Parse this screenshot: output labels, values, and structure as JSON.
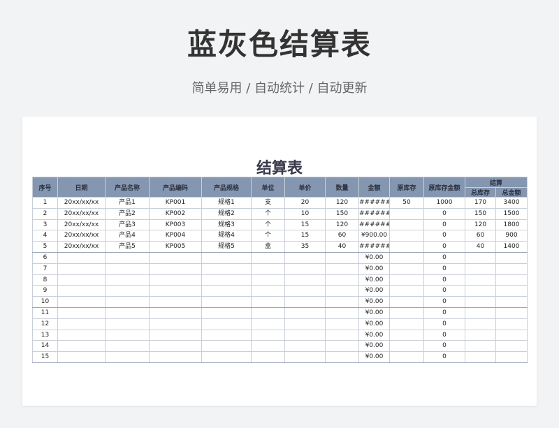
{
  "hero": {
    "title": "蓝灰色结算表",
    "subtitle": "简单易用 / 自动统计 / 自动更新"
  },
  "sheet": {
    "title": "结算表",
    "headers": [
      "序号",
      "日期",
      "产品名称",
      "产品编码",
      "产品规格",
      "单位",
      "单价",
      "数量",
      "金额",
      "原库存",
      "原库存金额"
    ],
    "group_header": "结算",
    "sub_headers": [
      "总库存",
      "总金额"
    ],
    "rows": [
      [
        "1",
        "20xx/xx/xx",
        "产品1",
        "KP001",
        "规格1",
        "支",
        "20",
        "120",
        "#######",
        "50",
        "1000",
        "170",
        "3400"
      ],
      [
        "2",
        "20xx/xx/xx",
        "产品2",
        "KP002",
        "规格2",
        "个",
        "10",
        "150",
        "#######",
        "",
        "0",
        "150",
        "1500"
      ],
      [
        "3",
        "20xx/xx/xx",
        "产品3",
        "KP003",
        "规格3",
        "个",
        "15",
        "120",
        "#######",
        "",
        "0",
        "120",
        "1800"
      ],
      [
        "4",
        "20xx/xx/xx",
        "产品4",
        "KP004",
        "规格4",
        "个",
        "15",
        "60",
        "¥900.00",
        "",
        "0",
        "60",
        "900"
      ],
      [
        "5",
        "20xx/xx/xx",
        "产品5",
        "KP005",
        "规格5",
        "盒",
        "35",
        "40",
        "#######",
        "",
        "0",
        "40",
        "1400"
      ],
      [
        "6",
        "",
        "",
        "",
        "",
        "",
        "",
        "",
        "¥0.00",
        "",
        "0",
        "",
        ""
      ],
      [
        "7",
        "",
        "",
        "",
        "",
        "",
        "",
        "",
        "¥0.00",
        "",
        "0",
        "",
        ""
      ],
      [
        "8",
        "",
        "",
        "",
        "",
        "",
        "",
        "",
        "¥0.00",
        "",
        "0",
        "",
        ""
      ],
      [
        "9",
        "",
        "",
        "",
        "",
        "",
        "",
        "",
        "¥0.00",
        "",
        "0",
        "",
        ""
      ],
      [
        "10",
        "",
        "",
        "",
        "",
        "",
        "",
        "",
        "¥0.00",
        "",
        "0",
        "",
        ""
      ],
      [
        "11",
        "",
        "",
        "",
        "",
        "",
        "",
        "",
        "¥0.00",
        "",
        "0",
        "",
        ""
      ],
      [
        "12",
        "",
        "",
        "",
        "",
        "",
        "",
        "",
        "¥0.00",
        "",
        "0",
        "",
        ""
      ],
      [
        "13",
        "",
        "",
        "",
        "",
        "",
        "",
        "",
        "¥0.00",
        "",
        "0",
        "",
        ""
      ],
      [
        "14",
        "",
        "",
        "",
        "",
        "",
        "",
        "",
        "¥0.00",
        "",
        "0",
        "",
        ""
      ],
      [
        "15",
        "",
        "",
        "",
        "",
        "",
        "",
        "",
        "¥0.00",
        "",
        "0",
        "",
        ""
      ]
    ]
  },
  "colors": {
    "header_bg": "#8496b0",
    "border": "#c9cfd8",
    "page_bg": "#f2f3f5"
  }
}
